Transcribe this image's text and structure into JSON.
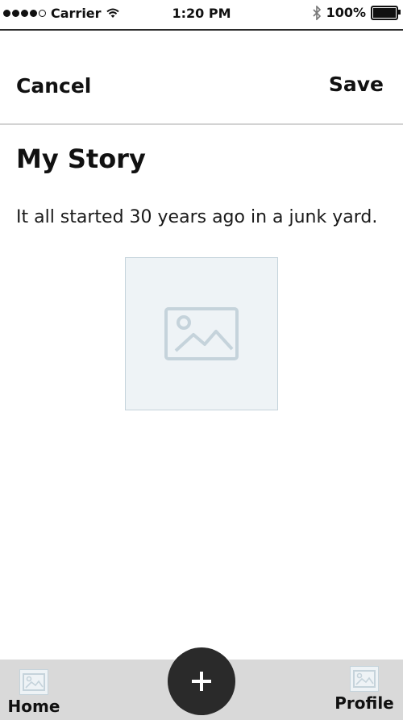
{
  "status_bar": {
    "carrier": "Carrier",
    "time": "1:20 PM",
    "battery": "100%"
  },
  "nav": {
    "cancel_label": "Cancel",
    "save_label": "Save"
  },
  "story": {
    "title": "My Story",
    "body": "It all started 30 years ago in a junk yard."
  },
  "tab_bar": {
    "home_label": "Home",
    "profile_label": "Profile"
  }
}
